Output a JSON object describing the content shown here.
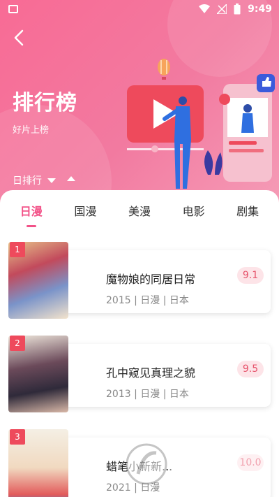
{
  "status": {
    "time": "9:49"
  },
  "header": {
    "title": "排行榜",
    "subtitle": "好片上榜",
    "period": "日排行"
  },
  "tabs": [
    {
      "label": "日漫",
      "active": true
    },
    {
      "label": "国漫",
      "active": false
    },
    {
      "label": "美漫",
      "active": false
    },
    {
      "label": "电影",
      "active": false
    },
    {
      "label": "剧集",
      "active": false
    }
  ],
  "items": [
    {
      "rank": "1",
      "title": "魔物娘的同居日常",
      "meta": "2015 | 日漫 | 日本",
      "score": "9.1"
    },
    {
      "rank": "2",
      "title": "孔中窥见真理之貌",
      "meta": "2013 | 日漫 | 日本",
      "score": "9.5"
    },
    {
      "rank": "3",
      "title": "蜡笔小新新...",
      "meta": "2021 | 日漫",
      "score": "10.0"
    }
  ],
  "colors": {
    "accent": "#f25288",
    "hero": "#f86b95",
    "badge": "#ee4a5c",
    "score_bg": "#fde4e8"
  }
}
